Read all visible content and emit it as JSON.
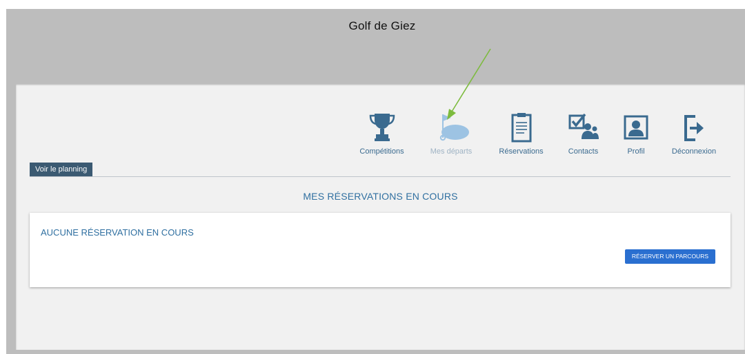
{
  "header": {
    "title": "Golf de Giez"
  },
  "nav": {
    "items": [
      {
        "label": "Compétitions",
        "icon": "trophy-icon"
      },
      {
        "label": "Mes départs",
        "icon": "golf-flag-icon"
      },
      {
        "label": "Réservations",
        "icon": "clipboard-icon"
      },
      {
        "label": "Contacts",
        "icon": "contacts-check-icon"
      },
      {
        "label": "Profil",
        "icon": "profile-icon"
      },
      {
        "label": "Déconnexion",
        "icon": "logout-icon"
      }
    ]
  },
  "planning": {
    "tab_label": "Voir le planning"
  },
  "reservations": {
    "section_title": "MES RÉSERVATIONS EN COURS",
    "empty_text": "AUCUNE RÉSERVATION EN COURS",
    "reserve_button": "RÉSERVER UN PARCOURS"
  },
  "colors": {
    "accent": "#2f6fa0",
    "icon": "#3a6a8f",
    "button": "#2a6fd0",
    "tab": "#3b5a72",
    "annotation_arrow": "#7dbb3e"
  }
}
